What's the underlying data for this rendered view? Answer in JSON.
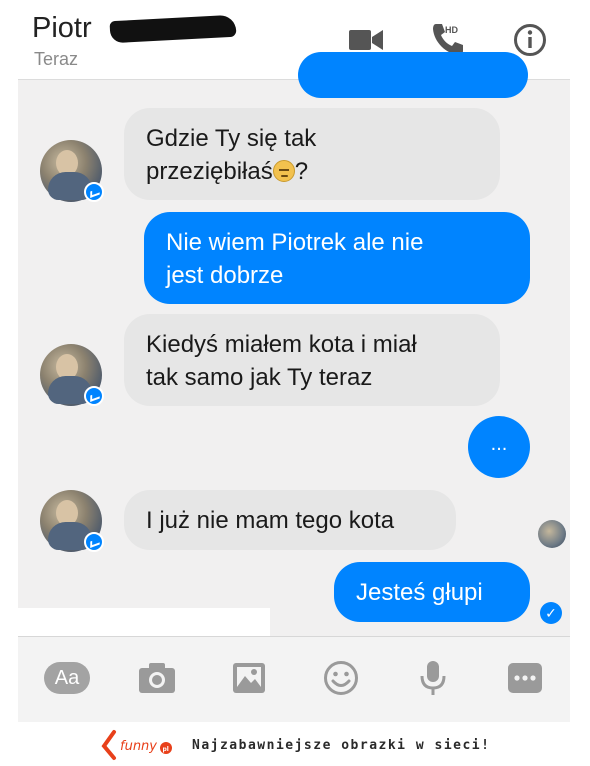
{
  "header": {
    "contact_name": "Piotr",
    "status": "Teraz",
    "icons": [
      "video-call-icon",
      "hd-phone-icon",
      "info-icon"
    ],
    "hd_label": "HD"
  },
  "messages": [
    {
      "direction": "incoming",
      "lines": [
        "Gdzie Ty się tak",
        "przeziębiłaś"
      ],
      "suffix": "?",
      "emoji": "sad-face-emoji"
    },
    {
      "direction": "outgoing",
      "lines": [
        "Nie wiem Piotrek ale nie",
        "jest dobrze"
      ]
    },
    {
      "direction": "incoming",
      "lines": [
        "Kiedyś miałem kota i miał",
        "tak samo jak Ty teraz"
      ]
    },
    {
      "direction": "outgoing",
      "text": "..."
    },
    {
      "direction": "incoming",
      "text": "I już nie mam tego kota"
    },
    {
      "direction": "outgoing",
      "text": "Jesteś głupi"
    }
  ],
  "toolbar": {
    "aa_label": "Aa",
    "icons": [
      "camera-icon",
      "gallery-icon",
      "emoji-icon",
      "microphone-icon",
      "more-icon"
    ]
  },
  "footer": {
    "logo_text": "funny",
    "logo_suffix": "pl",
    "tagline": "Najzabawniejsze obrazki w sieci!"
  },
  "colors": {
    "accent": "#0084ff",
    "incoming_bubble": "#e6e6e6",
    "background": "#f1f0f0"
  }
}
